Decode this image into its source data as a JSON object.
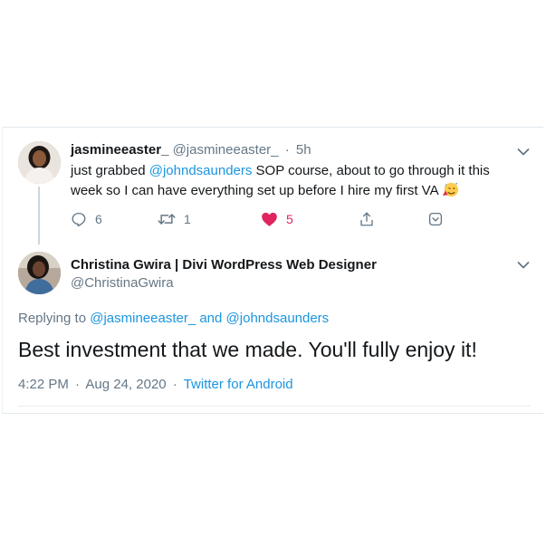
{
  "tweet1": {
    "display_name": "jasmineeaster_",
    "handle": "@jasmineeaster_",
    "separator": "·",
    "time": "5h",
    "text_part1": "just grabbed ",
    "mention": "@johndsaunders",
    "text_part2": " SOP course, about to go through it this week so I can have everything set up before I hire my first VA",
    "emoji": "partying-face-emoji",
    "actions": {
      "reply_count": "6",
      "retweet_count": "1",
      "like_count": "5"
    },
    "colors": {
      "like": "#e0245e",
      "link": "#1b95e0",
      "muted": "#657786"
    }
  },
  "tweet2": {
    "display_name": "Christina Gwira | Divi WordPress Web Designer",
    "handle": "@ChristinaGwira",
    "replying_prefix": "Replying to ",
    "replying_user1": "@jasmineeaster_",
    "replying_and": " and ",
    "replying_user2": "@johndsaunders",
    "text": "Best investment that we made. You'll fully enjoy it!",
    "time": "4:22 PM",
    "separator": "·",
    "date": "Aug 24, 2020",
    "source": "Twitter for Android"
  }
}
